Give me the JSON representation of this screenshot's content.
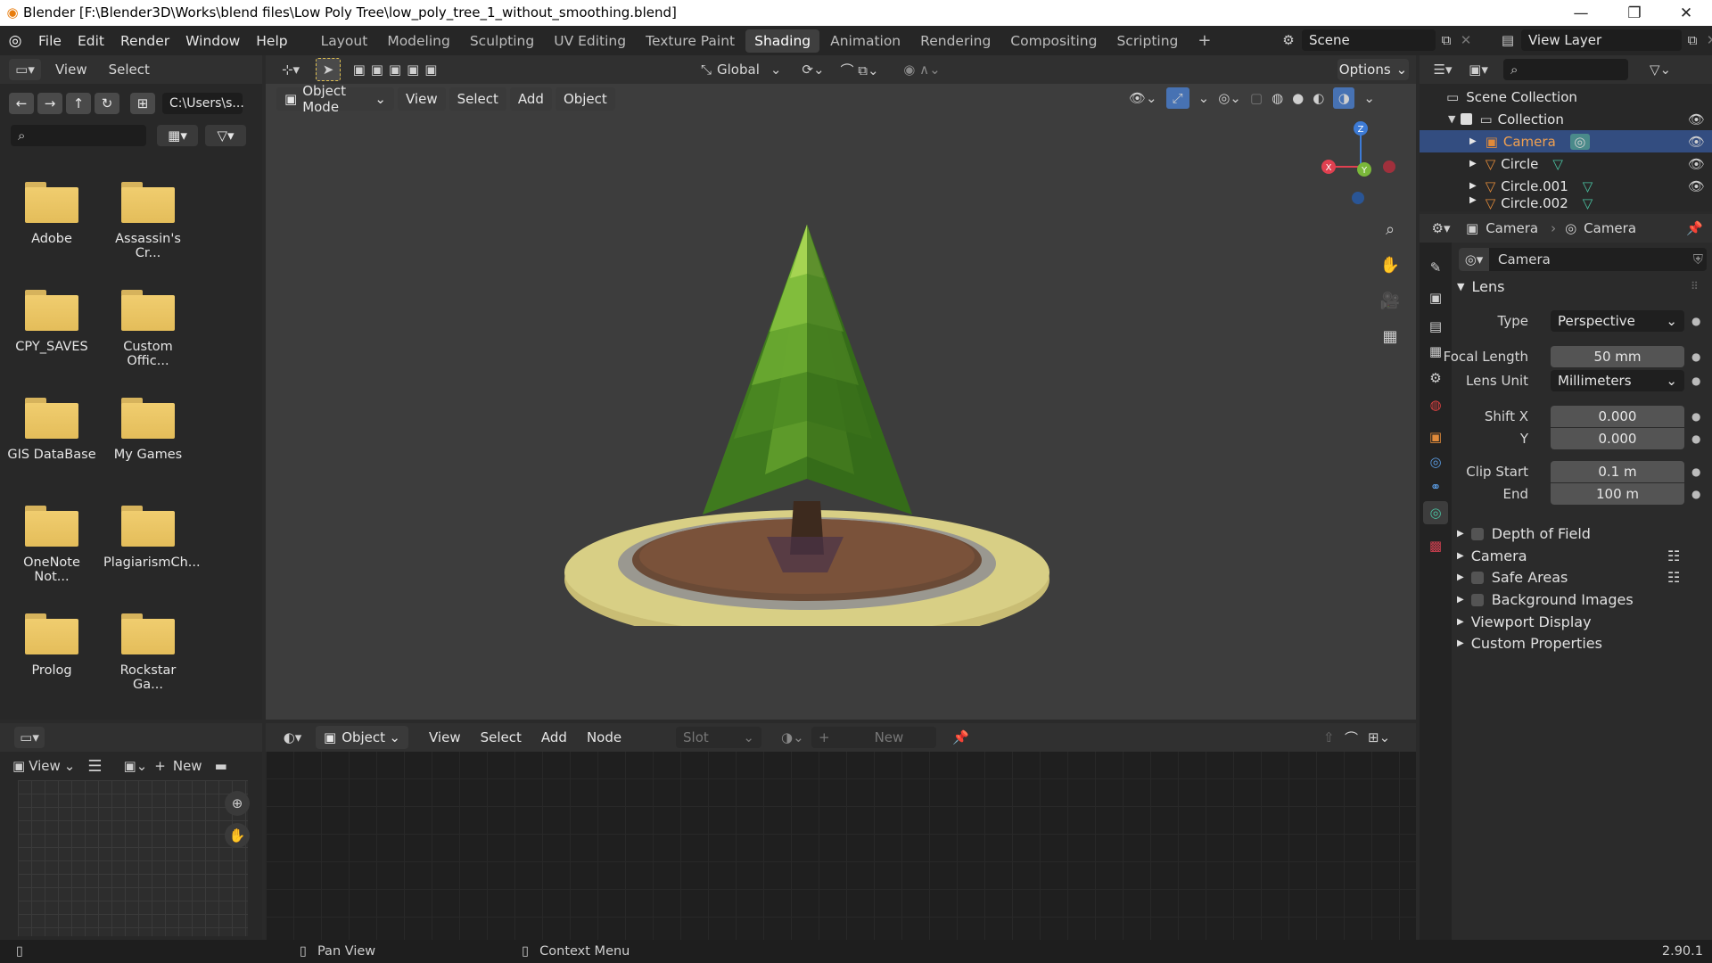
{
  "window": {
    "title": "Blender [F:\\Blender3D\\Works\\blend files\\Low Poly Tree\\low_poly_tree_1_without_smoothing.blend]",
    "minimize": "—",
    "maximize": "❐",
    "close": "✕"
  },
  "menu": [
    "File",
    "Edit",
    "Render",
    "Window",
    "Help"
  ],
  "workspaces": [
    "Layout",
    "Modeling",
    "Sculpting",
    "UV Editing",
    "Texture Paint",
    "Shading",
    "Animation",
    "Rendering",
    "Compositing",
    "Scripting"
  ],
  "active_workspace": "Shading",
  "add_workspace": "+",
  "scene": {
    "name": "Scene",
    "view_layer": "View Layer"
  },
  "file_browser": {
    "header": [
      "View",
      "Select"
    ],
    "path": "C:\\Users\\s...",
    "folders": [
      "Adobe",
      "Assassin's Cr...",
      "CPY_SAVES",
      "Custom Offic...",
      "GIS DataBase",
      "My Games",
      "OneNote Not...",
      "PlagiarismCh...",
      "Prolog",
      "Rockstar Ga..."
    ]
  },
  "viewport": {
    "orientation": "Global",
    "options": "Options",
    "mode": "Object Mode",
    "menus": [
      "View",
      "Select",
      "Add",
      "Object"
    ],
    "gizmo": {
      "x": "X",
      "y": "Y",
      "z": "Z"
    }
  },
  "shader_editor": {
    "object": "Object",
    "menus": [
      "View",
      "Select",
      "Add",
      "Node"
    ],
    "slot": "Slot",
    "new": "New"
  },
  "image_editor": {
    "view": "View",
    "new": "New"
  },
  "outliner": {
    "root": "Scene Collection",
    "collection": "Collection",
    "items": [
      "Camera",
      "Circle",
      "Circle.001",
      "Circle.002"
    ]
  },
  "properties": {
    "breadcrumb": [
      "Camera",
      "Camera"
    ],
    "datablock": "Camera",
    "lens_panel": "Lens",
    "type_label": "Type",
    "type_value": "Perspective",
    "focal_length_label": "Focal Length",
    "focal_length_value": "50 mm",
    "lens_unit_label": "Lens Unit",
    "lens_unit_value": "Millimeters",
    "shift_x_label": "Shift X",
    "shift_x_value": "0.000",
    "shift_y_label": "Y",
    "shift_y_value": "0.000",
    "clip_start_label": "Clip Start",
    "clip_start_value": "0.1 m",
    "clip_end_label": "End",
    "clip_end_value": "100 m",
    "panels": [
      "Depth of Field",
      "Camera",
      "Safe Areas",
      "Background Images",
      "Viewport Display",
      "Custom Properties"
    ]
  },
  "status": {
    "pan": "Pan View",
    "context": "Context Menu",
    "version": "2.90.1"
  },
  "colors": {
    "accent": "#4772b3",
    "selection": "#334d80",
    "folder": "#e8c264"
  }
}
